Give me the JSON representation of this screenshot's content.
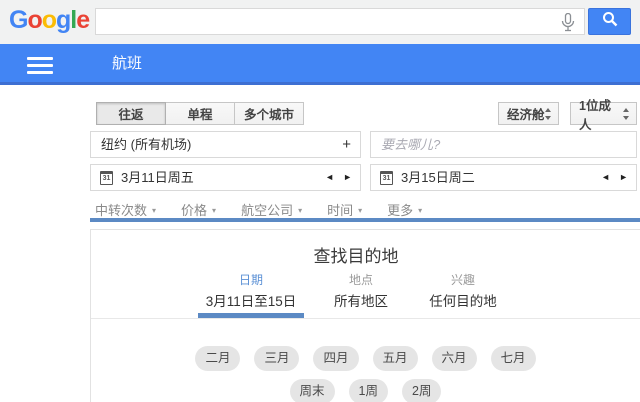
{
  "topbar": {
    "logo_letters": [
      {
        "ch": "G",
        "color": "#4285f4"
      },
      {
        "ch": "o",
        "color": "#ea4335"
      },
      {
        "ch": "o",
        "color": "#fbbc05"
      },
      {
        "ch": "g",
        "color": "#4285f4"
      },
      {
        "ch": "l",
        "color": "#34a853"
      },
      {
        "ch": "e",
        "color": "#ea4335"
      }
    ],
    "search_value": ""
  },
  "appbar": {
    "title": "航班"
  },
  "form": {
    "trip_tabs": [
      {
        "label": "往返",
        "selected": true
      },
      {
        "label": "单程",
        "selected": false
      },
      {
        "label": "多个城市",
        "selected": false
      }
    ],
    "cabin_value": "经济舱",
    "passengers_value": "1位成人",
    "origin_value": "纽约 (所有机场)",
    "destination_placeholder": "要去哪儿?",
    "depart_date": "3月11日周五",
    "return_date": "3月15日周二",
    "filters": [
      "中转次数",
      "价格",
      "航空公司",
      "时间",
      "更多"
    ]
  },
  "card": {
    "title": "查找目的地",
    "tabs": [
      {
        "label": "日期",
        "value": "3月11日至15日",
        "selected": true
      },
      {
        "label": "地点",
        "value": "所有地区",
        "selected": false
      },
      {
        "label": "兴趣",
        "value": "任何目的地",
        "selected": false
      }
    ],
    "month_pills": [
      "二月",
      "三月",
      "四月",
      "五月",
      "六月",
      "七月"
    ],
    "duration_pills": [
      "周末",
      "1周",
      "2周"
    ]
  },
  "icons": {
    "caret_down": "▾",
    "plus": "+",
    "prev_arrow": "◄",
    "next_arrow": "►",
    "calendar_day": "31"
  },
  "colors": {
    "brand_blue": "#4285f4",
    "appbar_border_blue": "#3d6fd2",
    "divider_blue": "#5c8ac4",
    "selected_tab_blue": "#5b90d5",
    "logo_red": "#ea4335",
    "logo_yellow": "#fbbc05",
    "logo_green": "#34a853",
    "pill_gray": "#e5e5e5",
    "topstrip_gray": "#f1f2f2"
  }
}
